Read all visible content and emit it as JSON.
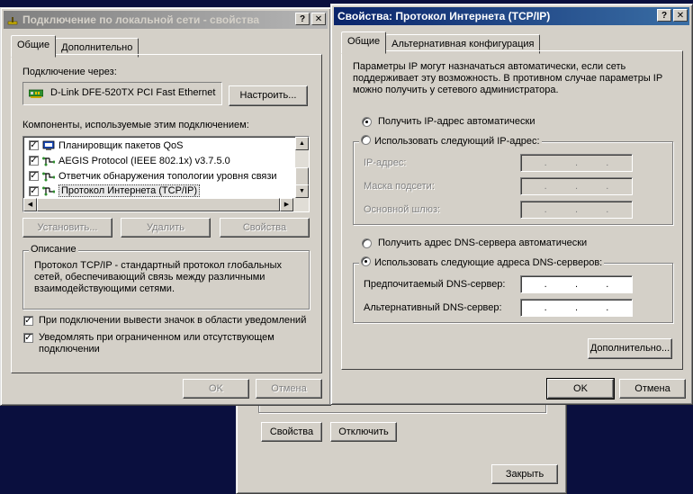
{
  "lan_dialog": {
    "title": "Подключение по локальной сети - свойства",
    "tabs": [
      "Общие",
      "Дополнительно"
    ],
    "connect_using_label": "Подключение через:",
    "adapter_name": "D-Link DFE-520TX PCI Fast Ethernet",
    "configure_button": "Настроить...",
    "components_label": "Компоненты, используемые этим подключением:",
    "components": [
      {
        "label": "Планировщик пакетов QoS",
        "checked": true,
        "icon": "qos-scheduler-icon"
      },
      {
        "label": "AEGIS Protocol (IEEE 802.1x) v3.7.5.0",
        "checked": true,
        "icon": "network-protocol-icon"
      },
      {
        "label": "Ответчик обнаружения топологии уровня связи",
        "checked": true,
        "icon": "network-protocol-icon"
      },
      {
        "label": "Протокол Интернета (TCP/IP)",
        "checked": true,
        "icon": "network-protocol-icon"
      }
    ],
    "install_button": "Установить...",
    "uninstall_button": "Удалить",
    "properties_button": "Свойства",
    "description_title": "Описание",
    "description_text": "Протокол TCP/IP - стандартный протокол глобальных сетей, обеспечивающий связь между различными взаимодействующими сетями.",
    "show_icon_label": "При подключении вывести значок в области уведомлений",
    "notify_label": "Уведомлять при ограниченном или отсутствующем подключении",
    "ok_button": "OK",
    "cancel_button": "Отмена",
    "help_glyph": "?",
    "close_glyph": "✕"
  },
  "status_dialog": {
    "properties_button": "Свойства",
    "disable_button": "Отключить",
    "close_button": "Закрыть"
  },
  "tcpip_dialog": {
    "title": "Свойства: Протокол Интернета (TCP/IP)",
    "tabs": [
      "Общие",
      "Альтернативная конфигурация"
    ],
    "intro_text": "Параметры IP могут назначаться автоматически, если сеть поддерживает эту возможность. В противном случае параметры IP можно получить у сетевого администратора.",
    "auto_ip_label": "Получить IP-адрес автоматически",
    "manual_ip_label": "Использовать следующий IP-адрес:",
    "ip_address_label": "IP-адрес:",
    "subnet_label": "Маска подсети:",
    "gateway_label": "Основной шлюз:",
    "auto_dns_label": "Получить адрес DNS-сервера автоматически",
    "manual_dns_label": "Использовать следующие адреса DNS-серверов:",
    "preferred_dns_label": "Предпочитаемый DNS-сервер:",
    "alternate_dns_label": "Альтернативный DNS-сервер:",
    "ip_dot": ".",
    "advanced_button": "Дополнительно...",
    "ok_button": "OK",
    "cancel_button": "Отмена",
    "help_glyph": "?",
    "close_glyph": "✕"
  },
  "colors": {
    "desktop": "#0a0f3e",
    "active_title_start": "#0a246a",
    "active_title_end": "#3a6ea5",
    "inactive_title": "#808080",
    "face": "#d4d0c8",
    "selection": "#0a246a"
  }
}
